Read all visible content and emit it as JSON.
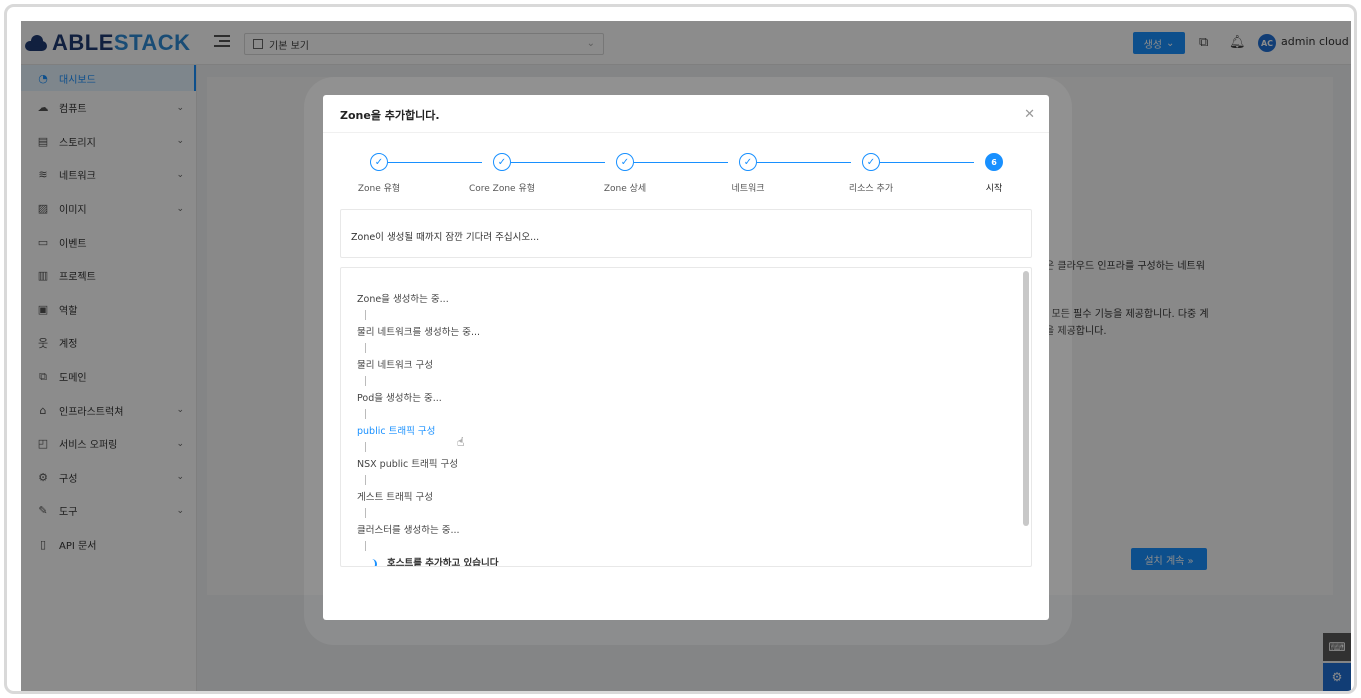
{
  "header": {
    "logo_part1": "ABLE",
    "logo_part2": "STACK",
    "view_select": "기본 보기",
    "create_label": "생성",
    "username": "admin cloud",
    "avatar_initials": "AC"
  },
  "sidebar": {
    "items": [
      {
        "label": "대시보드",
        "icon": "dashboard-icon",
        "active": true
      },
      {
        "label": "컴퓨트",
        "icon": "cloud-icon",
        "expandable": true
      },
      {
        "label": "스토리지",
        "icon": "storage-icon",
        "expandable": true
      },
      {
        "label": "네트워크",
        "icon": "wifi-icon",
        "expandable": true
      },
      {
        "label": "이미지",
        "icon": "image-icon",
        "expandable": true
      },
      {
        "label": "이벤트",
        "icon": "calendar-icon"
      },
      {
        "label": "프로젝트",
        "icon": "project-icon"
      },
      {
        "label": "역할",
        "icon": "id-card-icon"
      },
      {
        "label": "계정",
        "icon": "team-icon"
      },
      {
        "label": "도메인",
        "icon": "block-icon"
      },
      {
        "label": "인프라스트럭쳐",
        "icon": "bank-icon",
        "expandable": true
      },
      {
        "label": "서비스 오퍼링",
        "icon": "shopping-icon",
        "expandable": true
      },
      {
        "label": "구성",
        "icon": "setting-icon",
        "expandable": true
      },
      {
        "label": "도구",
        "icon": "tool-icon",
        "expandable": true
      },
      {
        "label": "API 문서",
        "icon": "read-icon"
      }
    ]
  },
  "background": {
    "line1": "은 클라우드 인프라를 구성하는 네트워",
    "line2": "| 모든 필수 기능을 제공합니다. 다중 계",
    "line3": "을 제공합니다.",
    "install_button": "설치 계속 »"
  },
  "modal": {
    "title": "Zone을 추가합니다.",
    "steps": [
      {
        "label": "Zone 유형",
        "done": true
      },
      {
        "label": "Core Zone 유형",
        "done": true
      },
      {
        "label": "Zone 상세",
        "done": true
      },
      {
        "label": "네트워크",
        "done": true
      },
      {
        "label": "리소스 추가",
        "done": true
      },
      {
        "label": "시작",
        "number": "6",
        "current": true
      }
    ],
    "check_mark": "✓",
    "status_message": "Zone이 생성될 때까지 잠깐 기다려 주십시오...",
    "log": [
      {
        "text": "Zone을 생성하는 중...",
        "state": "done"
      },
      {
        "text": "물리 네트워크를 생성하는 중...",
        "state": "done"
      },
      {
        "text": "물리 네트워크 구성",
        "state": "done"
      },
      {
        "text": "Pod을 생성하는 중...",
        "state": "done"
      },
      {
        "text": "public 트래픽 구성",
        "state": "active"
      },
      {
        "text": "NSX public 트래픽 구성",
        "state": "done"
      },
      {
        "text": "게스트 트래픽 구성",
        "state": "done"
      },
      {
        "text": "클러스터를 생성하는 중...",
        "state": "done"
      },
      {
        "text": "호스트를 추가하고 있습니다",
        "state": "pending"
      }
    ]
  },
  "colors": {
    "primary": "#1890ff",
    "logo_dark": "#1f3b73",
    "logo_light": "#2f8bd6"
  }
}
